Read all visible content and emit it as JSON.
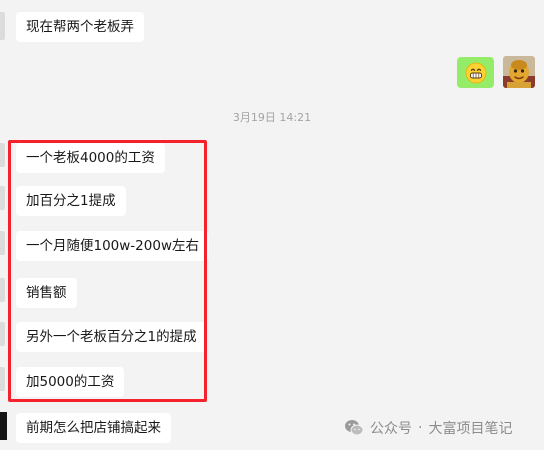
{
  "messages": [
    {
      "id": "m1",
      "text": "现在帮两个老板弄"
    },
    {
      "id": "m2",
      "text": "一个老板4000的工资"
    },
    {
      "id": "m3",
      "text": "加百分之1提成"
    },
    {
      "id": "m4",
      "text": "一个月随便100w-200w左右"
    },
    {
      "id": "m5",
      "text": "销售额"
    },
    {
      "id": "m6",
      "text": "另外一个老板百分之1的提成"
    },
    {
      "id": "m7",
      "text": "加5000的工资"
    },
    {
      "id": "m8",
      "text": "前期怎么把店铺搞起来"
    }
  ],
  "timestamp": "3月19日 14:21",
  "sent": {
    "emoji": "grinning-emoji",
    "avatar": "avatar-image"
  },
  "watermark": {
    "separator": "·",
    "source": "公众号",
    "account": "大富项目笔记"
  },
  "colors": {
    "highlight": "#f5222d",
    "sent_bubble": "#95ec69",
    "background": "#f3f3f3"
  }
}
